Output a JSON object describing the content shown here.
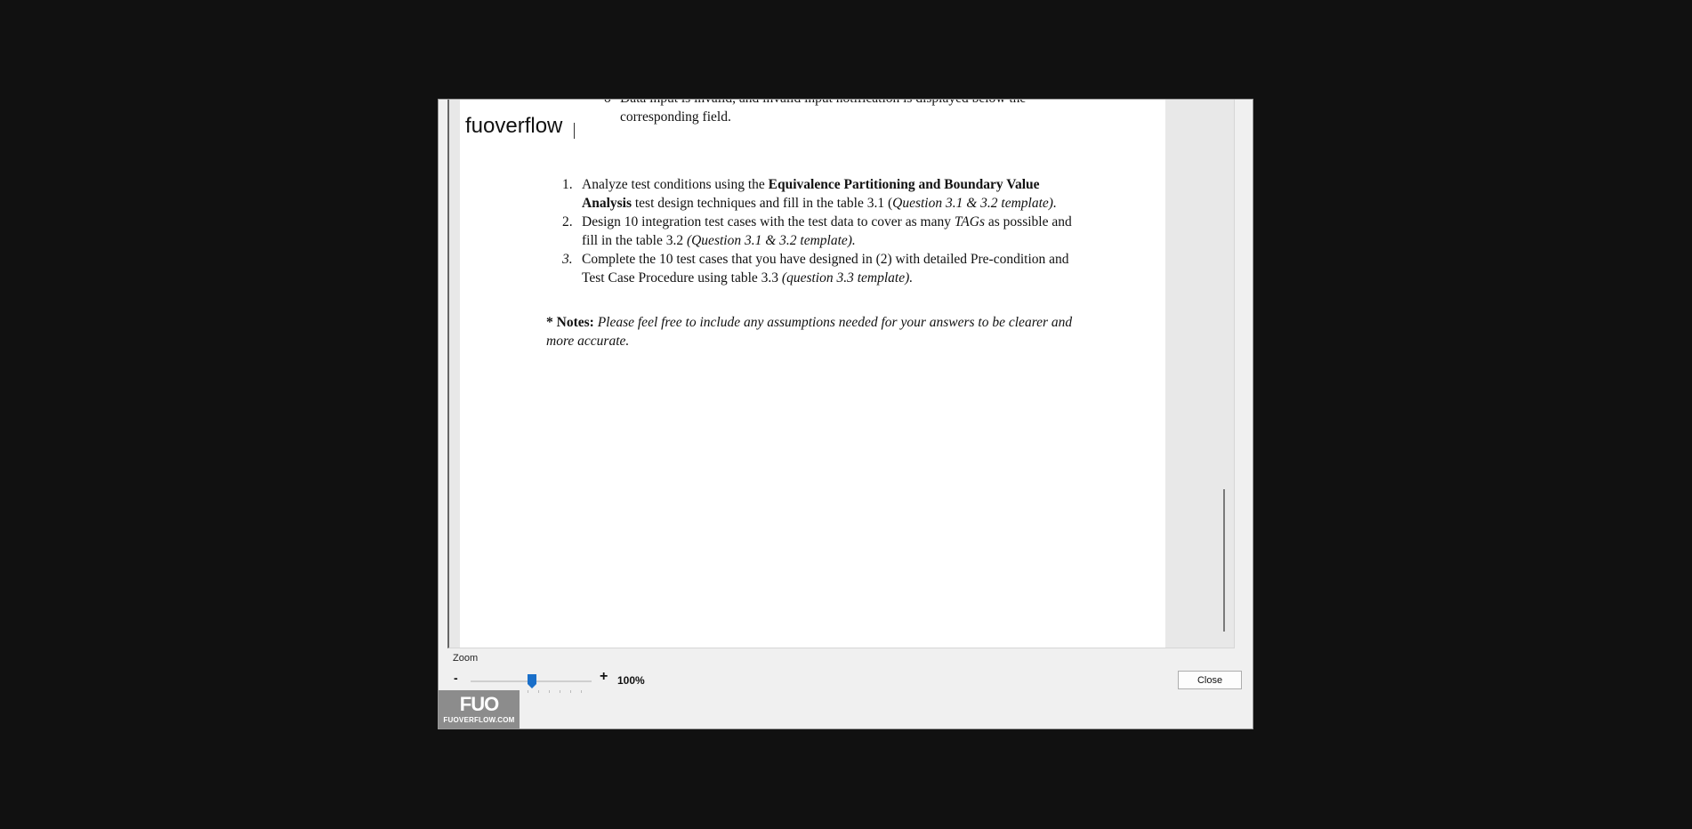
{
  "document": {
    "cut_line1": "Data input is invalid, and invalid input notification is displayed below the",
    "cut_line2": "corresponding field.",
    "bullet": "o",
    "tasks": [
      {
        "num": "1.",
        "pre": "Analyze test conditions using the ",
        "bold": "Equivalence Partitioning and Boundary Value Analysis",
        "mid": " test design techniques and fill in the table 3.1 (",
        "italic": "Question 3.1 & 3.2 template)."
      },
      {
        "num": "2.",
        "pre": "Design 10 integration test cases with the test data to cover as many ",
        "italic_mid": "TAGs",
        "mid": " as possible and fill in the table 3.2 ",
        "italic": "(Question 3.1 & 3.2 template)."
      },
      {
        "num": "3.",
        "pre": "Complete the 10 test cases that you have designed in (2) with detailed Pre-condition and Test Case Procedure using table 3.3 ",
        "italic": "(question 3.3 template)."
      }
    ],
    "notes_label": "* Notes:",
    "notes_text": "Please feel free to include any assumptions needed for your answers to be clearer and more accurate."
  },
  "watermark": "fuoverflow",
  "zoom": {
    "label": "Zoom",
    "minus": "-",
    "plus": "+",
    "value": "100%",
    "level_percent": 100
  },
  "close_label": "Close",
  "logo": {
    "mark": "FUO",
    "site": "FUOVERFLOW.COM"
  },
  "colors": {
    "slider_thumb": "#1a6fc9",
    "backdrop": "#111111",
    "logo_bg": "#8c8c8c"
  }
}
